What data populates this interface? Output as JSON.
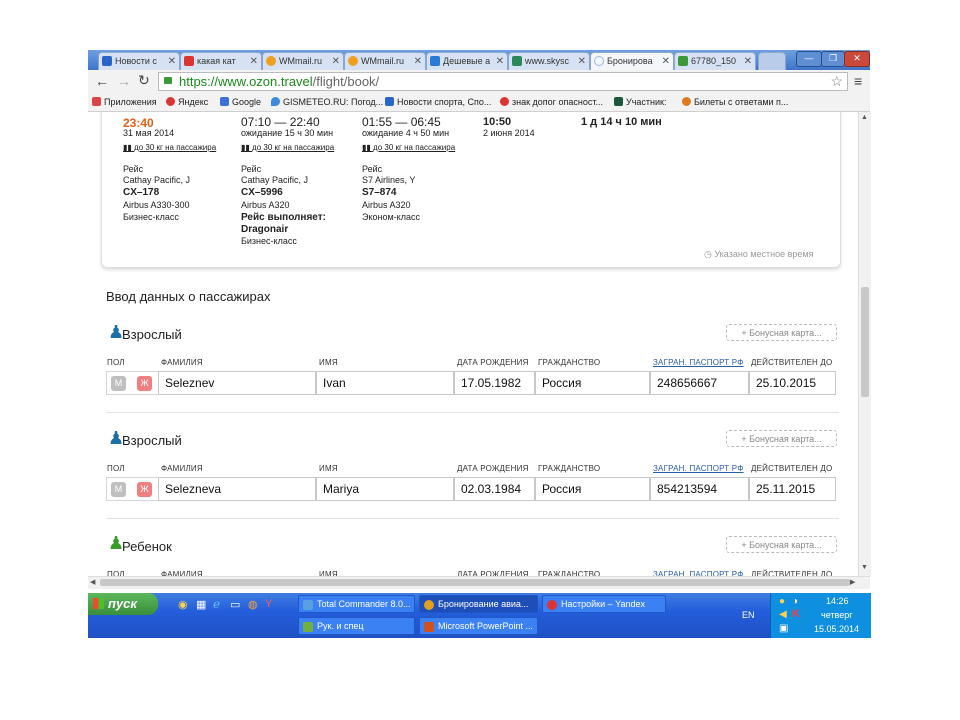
{
  "browser": {
    "tabs": [
      {
        "label": "Новости с",
        "color": "#2a65c8",
        "icon": "news-icon"
      },
      {
        "label": "какая кат",
        "color": "#d33",
        "icon": "yandex-icon"
      },
      {
        "label": "WMmail.ru",
        "color": "#f0a020",
        "icon": "mail-icon"
      },
      {
        "label": "WMmail.ru",
        "color": "#f0a020",
        "icon": "mail-icon"
      },
      {
        "label": "Дешевые а",
        "color": "#2a7bd8",
        "icon": "plane-icon"
      },
      {
        "label": "www.skysc",
        "color": "#2a8a5a",
        "icon": "skyscanner-icon"
      },
      {
        "label": "Бронирова",
        "color": "#9bb8e0",
        "icon": "loading-icon"
      },
      {
        "label": "67780_150",
        "color": "#3a9a3a",
        "icon": "image-icon"
      }
    ],
    "url_host": "https://www.ozon.travel",
    "url_path": "/flight/book/",
    "bookmarks": [
      "Приложения",
      "Яндекс",
      "Google",
      "GISMETEO.RU: Погод...",
      "Новости спорта, Спо...",
      "знак допог опасност...",
      "Участник:",
      "Билеты с ответами п..."
    ]
  },
  "flights": {
    "seg0": {
      "time": "23:40",
      "date": "31 мая 2014",
      "baggage": "до 30 кг на пассажира",
      "rейс": "Рейс",
      "airline": "Cathay Pacific, J",
      "number": "CX–178",
      "aircraft": "Airbus A330-300",
      "class": "Бизнес-класс"
    },
    "seg1": {
      "time": "07:10 — 22:40",
      "wait": "ожидание 15 ч 30 мин",
      "baggage": "до 30 кг на пассажира",
      "rейс": "Рейс",
      "airline": "Cathay Pacific, J",
      "number": "CX–5996",
      "aircraft": "Airbus A320",
      "operated_label": "Рейс выполняет:",
      "operator": "Dragonair",
      "class": "Бизнес-класс"
    },
    "seg2": {
      "time": "01:55 — 06:45",
      "wait": "ожидание 4 ч 50 мин",
      "baggage": "до 30 кг на пассажира",
      "rейс": "Рейс",
      "airline": "S7 Airlines, Y",
      "number": "S7–874",
      "aircraft": "Airbus A320",
      "class": "Эконом-класс"
    },
    "arrival": {
      "time": "10:50",
      "date": "2 июня 2014"
    },
    "duration": "1 д 14 ч 10 мин",
    "local_time_note": "Указано местное время"
  },
  "passengers_title": "Ввод данных о пассажирах",
  "labels": {
    "gender": "ПОЛ",
    "surname": "ФАМИЛИЯ",
    "name": "ИМЯ",
    "birth": "ДАТА РОЖДЕНИЯ",
    "citizenship": "ГРАЖДАНСТВО",
    "passport": "ЗАГРАН. ПАСПОРТ РФ",
    "valid": "ДЕЙСТВИТЕЛЕН ДО",
    "male": "М",
    "female": "Ж",
    "bonus": "+ Бонусная карта..."
  },
  "passengers": [
    {
      "type": "Взрослый",
      "surname": "Seleznev",
      "name": "Ivan",
      "birth": "17.05.1982",
      "citizenship": "Россия",
      "passport": "248656667",
      "valid": "25.10.2015"
    },
    {
      "type": "Взрослый",
      "surname": "Selezneva",
      "name": "Mariya",
      "birth": "02.03.1984",
      "citizenship": "Россия",
      "passport": "854213594",
      "valid": "25.11.2015"
    },
    {
      "type": "Ребенок"
    }
  ],
  "taskbar": {
    "start": "пуск",
    "items": [
      {
        "label": "Total Commander 8.0...",
        "color": "#5aa0e0"
      },
      {
        "label": "Бронирование авиа...",
        "color": "#e0a020"
      },
      {
        "label": "Настройки – Yandex",
        "color": "#d33"
      },
      {
        "label": "Рук. и спец",
        "color": "#70b040"
      },
      {
        "label": "Microsoft PowerPoint ...",
        "color": "#d05020"
      }
    ],
    "lang": "EN",
    "time": "14:26",
    "day": "четверг",
    "date": "15.05.2014"
  }
}
